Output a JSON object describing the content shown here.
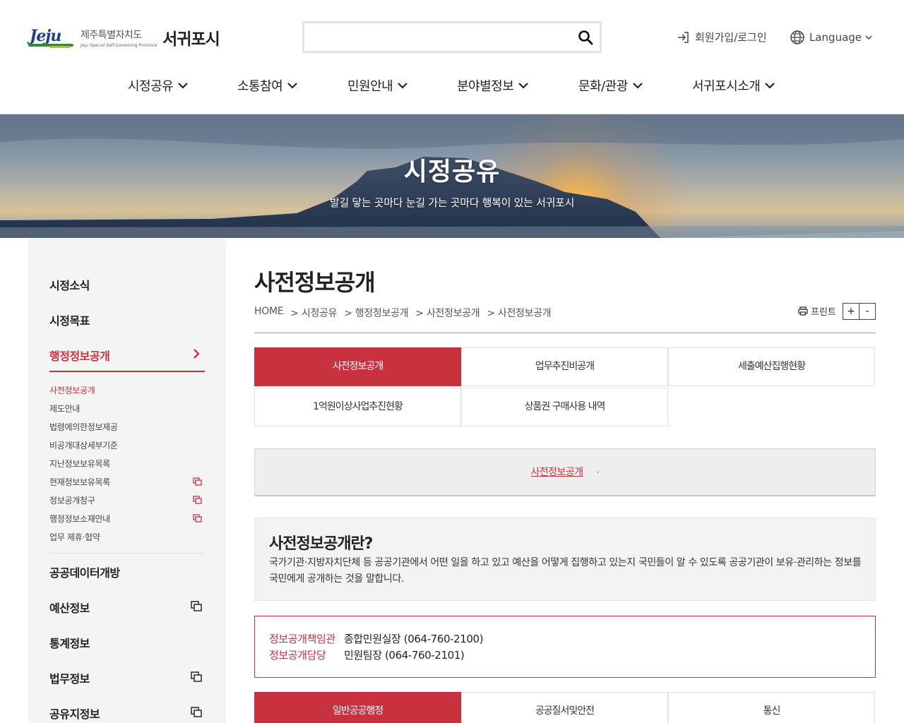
{
  "header": {
    "logo_mark": "Jeju",
    "logo_province": "제주특별자치도",
    "logo_province_en": "Jeju Special Self-Governing Province",
    "logo_city": "서귀포시",
    "search_placeholder": "",
    "login_label": "회원가입/로그인",
    "language_label": "Language"
  },
  "gnb": [
    {
      "label": "시정공유"
    },
    {
      "label": "소통참여"
    },
    {
      "label": "민원안내"
    },
    {
      "label": "분야별정보"
    },
    {
      "label": "문화/관광"
    },
    {
      "label": "서귀포시소개"
    }
  ],
  "banner": {
    "title": "시정공유",
    "subtitle": "발길 닿는 곳마다 눈길 가는 곳마다 행복이 있는 서귀포시"
  },
  "sidebar": {
    "items": [
      {
        "label": "시정소식"
      },
      {
        "label": "시정목표"
      },
      {
        "label": "행정정보공개"
      }
    ],
    "sub_items": [
      {
        "label": "사전정보공개"
      },
      {
        "label": "제도안내"
      },
      {
        "label": "법령에의한정보제공"
      },
      {
        "label": "비공개대상세부기준"
      },
      {
        "label": "지난정보보유목록"
      },
      {
        "label": "현재정보보유목록"
      },
      {
        "label": "정보공개청구"
      },
      {
        "label": "행정정보소재안내"
      },
      {
        "label": "업무 제휴·협약"
      }
    ],
    "more_items": [
      {
        "label": "공공데이터개방"
      },
      {
        "label": "예산정보"
      },
      {
        "label": "통계정보"
      },
      {
        "label": "법무정보"
      },
      {
        "label": "공유지정보"
      }
    ]
  },
  "content": {
    "title": "사전정보공개",
    "breadcrumb": [
      "HOME",
      "> 시정공유",
      "> 행정정보공개",
      "> 사전정보공개",
      "> 사전정보공개"
    ],
    "print_label": "프린트",
    "zoom_in": "+",
    "zoom_out": "-",
    "tabs": [
      {
        "label": "사전정보공개"
      },
      {
        "label": "업무추진비공개"
      },
      {
        "label": "세출예산집행현황"
      },
      {
        "label": "1억원이상사업추진현황"
      },
      {
        "label": "상품권 구매사용 내역"
      }
    ],
    "sub_link": "사전정보공개",
    "sub_dot": "·",
    "info_title": "사전정보공개란?",
    "info_text": "국가기관·지방자치단체 등 공공기관에서 어떤 일을 하고 있고 예산을 어떻게 집행하고 있는지 국민들이 알 수 있도록 공공기관이 보유·관리하는 정보를 국민에게 공개하는 것을 말합니다.",
    "contacts": [
      {
        "key": "정보공개책임관",
        "value": "종합민원실장  (064-760-2100)"
      },
      {
        "key": "정보공개담당",
        "value": "민원팀장  (064-760-2101)"
      }
    ],
    "category_tabs": [
      {
        "label": "일반공공행정"
      },
      {
        "label": "공공질서및안전"
      },
      {
        "label": "통신"
      }
    ]
  },
  "colors": {
    "accent": "#c8323f",
    "sidebar_bg": "#f4f4f4"
  }
}
